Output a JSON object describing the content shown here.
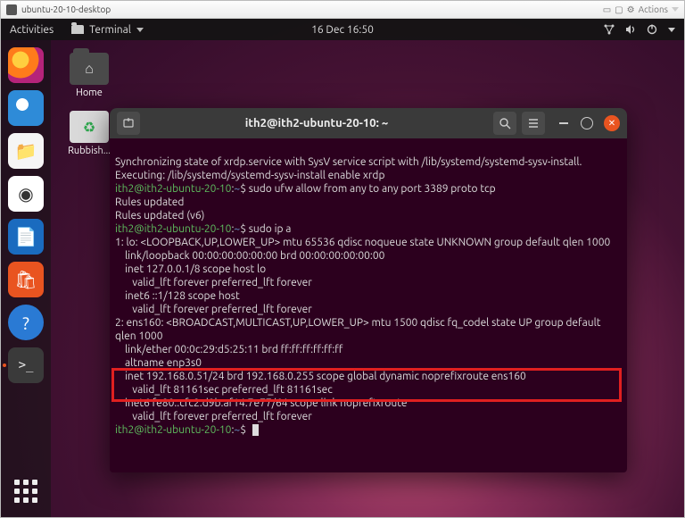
{
  "vm": {
    "title": "ubuntu-20-10-desktop",
    "actions_label": "Actions"
  },
  "topbar": {
    "activities": "Activities",
    "appmenu": "Terminal",
    "clock": "16 Dec  16:50"
  },
  "desktop": {
    "home_label": "Home",
    "trash_label": "Rubbish..."
  },
  "dock": {
    "items": [
      "firefox",
      "thunderbird",
      "files",
      "rhythmbox",
      "libreoffice-writer",
      "ubuntu-software",
      "help",
      "terminal"
    ]
  },
  "terminal": {
    "title": "ith2@ith2-ubuntu-20-10: ~",
    "newtab_tooltip": "New Tab",
    "prompt": {
      "userhost": "ith2@ith2-ubuntu-20-10",
      "sep": ":",
      "path": "~",
      "end": "$"
    },
    "lines": {
      "l01": "Synchronizing state of xrdp.service with SysV service script with /lib/systemd/systemd-sysv-install.",
      "l02": "Executing: /lib/systemd/systemd-sysv-install enable xrdp",
      "cmd1": " sudo ufw allow from any to any port 3389 proto tcp",
      "l03": "Rules updated",
      "l04": "Rules updated (v6)",
      "cmd2": " sudo ip a",
      "l05": "1: lo: <LOOPBACK,UP,LOWER_UP> mtu 65536 qdisc noqueue state UNKNOWN group default qlen 1000",
      "l06": "    link/loopback 00:00:00:00:00:00 brd 00:00:00:00:00:00",
      "l07": "    inet 127.0.0.1/8 scope host lo",
      "l08": "       valid_lft forever preferred_lft forever",
      "l09": "    inet6 ::1/128 scope host",
      "l10": "       valid_lft forever preferred_lft forever",
      "l11": "2: ens160: <BROADCAST,MULTICAST,UP,LOWER_UP> mtu 1500 qdisc fq_codel state UP group default qlen 1000",
      "l12": "    link/ether 00:0c:29:d5:25:11 brd ff:ff:ff:ff:ff:ff",
      "l13": "    altname enp3s0",
      "l14": "    inet 192.168.0.51/24 brd 192.168.0.255 scope global dynamic noprefixroute ens160",
      "l15": "       valid_lft 81161sec preferred_lft 81161sec",
      "l16": "    inet6 fe80::cfc2:d9b:af14:7e77/64 scope link noprefixroute",
      "l17": "       valid_lft forever preferred_lft forever"
    }
  }
}
